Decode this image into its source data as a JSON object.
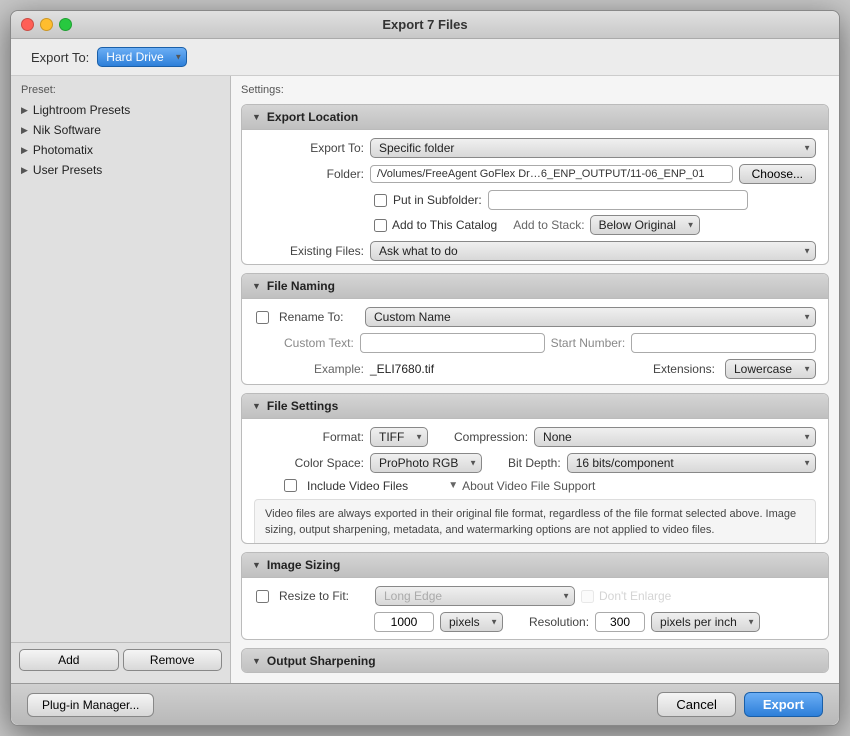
{
  "window": {
    "title": "Export 7 Files"
  },
  "export_to_bar": {
    "label": "Export To:",
    "value": "Hard Drive"
  },
  "sidebar": {
    "label": "Preset:",
    "items": [
      {
        "id": "lightroom-presets",
        "label": "Lightroom Presets"
      },
      {
        "id": "nik-software",
        "label": "Nik Software"
      },
      {
        "id": "photomatix",
        "label": "Photomatix"
      },
      {
        "id": "user-presets",
        "label": "User Presets"
      }
    ]
  },
  "settings": {
    "label": "Settings:"
  },
  "export_location": {
    "title": "Export Location",
    "export_to_label": "Export To:",
    "export_to_value": "Specific folder",
    "folder_label": "Folder:",
    "folder_path": "/Volumes/FreeAgent GoFlex Dr…6_ENP_OUTPUT/11-06_ENP_01",
    "choose_btn": "Choose...",
    "put_in_subfolder_label": "Put in Subfolder:",
    "add_to_catalog_label": "Add to This Catalog",
    "add_to_stack_label": "Add to Stack:",
    "add_to_stack_value": "Below Original",
    "existing_files_label": "Existing Files:",
    "existing_files_value": "Ask what to do"
  },
  "file_naming": {
    "title": "File Naming",
    "rename_to_label": "Rename To:",
    "rename_to_value": "Custom Name",
    "custom_text_label": "Custom Text:",
    "start_number_label": "Start Number:",
    "example_label": "Example:",
    "example_value": "_ELI7680.tif",
    "extensions_label": "Extensions:",
    "extensions_value": "Lowercase"
  },
  "file_settings": {
    "title": "File Settings",
    "format_label": "Format:",
    "format_value": "TIFF",
    "compression_label": "Compression:",
    "compression_value": "None",
    "color_space_label": "Color Space:",
    "color_space_value": "ProPhoto RGB",
    "bit_depth_label": "Bit Depth:",
    "bit_depth_value": "16 bits/component",
    "include_video_label": "Include Video Files",
    "about_video_label": "About Video File Support",
    "video_info": "Video files are always exported in their original file format, regardless of the file format selected above. Image sizing, output sharpening, metadata, and watermarking options are not applied to video files."
  },
  "image_sizing": {
    "title": "Image Sizing",
    "resize_label": "Resize to Fit:",
    "resize_value": "Long Edge",
    "dont_enlarge_label": "Don't Enlarge",
    "pixels_value": "1000",
    "pixels_unit": "pixels",
    "resolution_label": "Resolution:",
    "resolution_value": "300",
    "resolution_unit": "pixels per inch"
  },
  "output_sharpening": {
    "title": "Output Sharpening"
  },
  "bottom_bar": {
    "plugin_btn": "Plug-in Manager...",
    "add_btn": "Add",
    "remove_btn": "Remove",
    "cancel_btn": "Cancel",
    "export_btn": "Export"
  }
}
